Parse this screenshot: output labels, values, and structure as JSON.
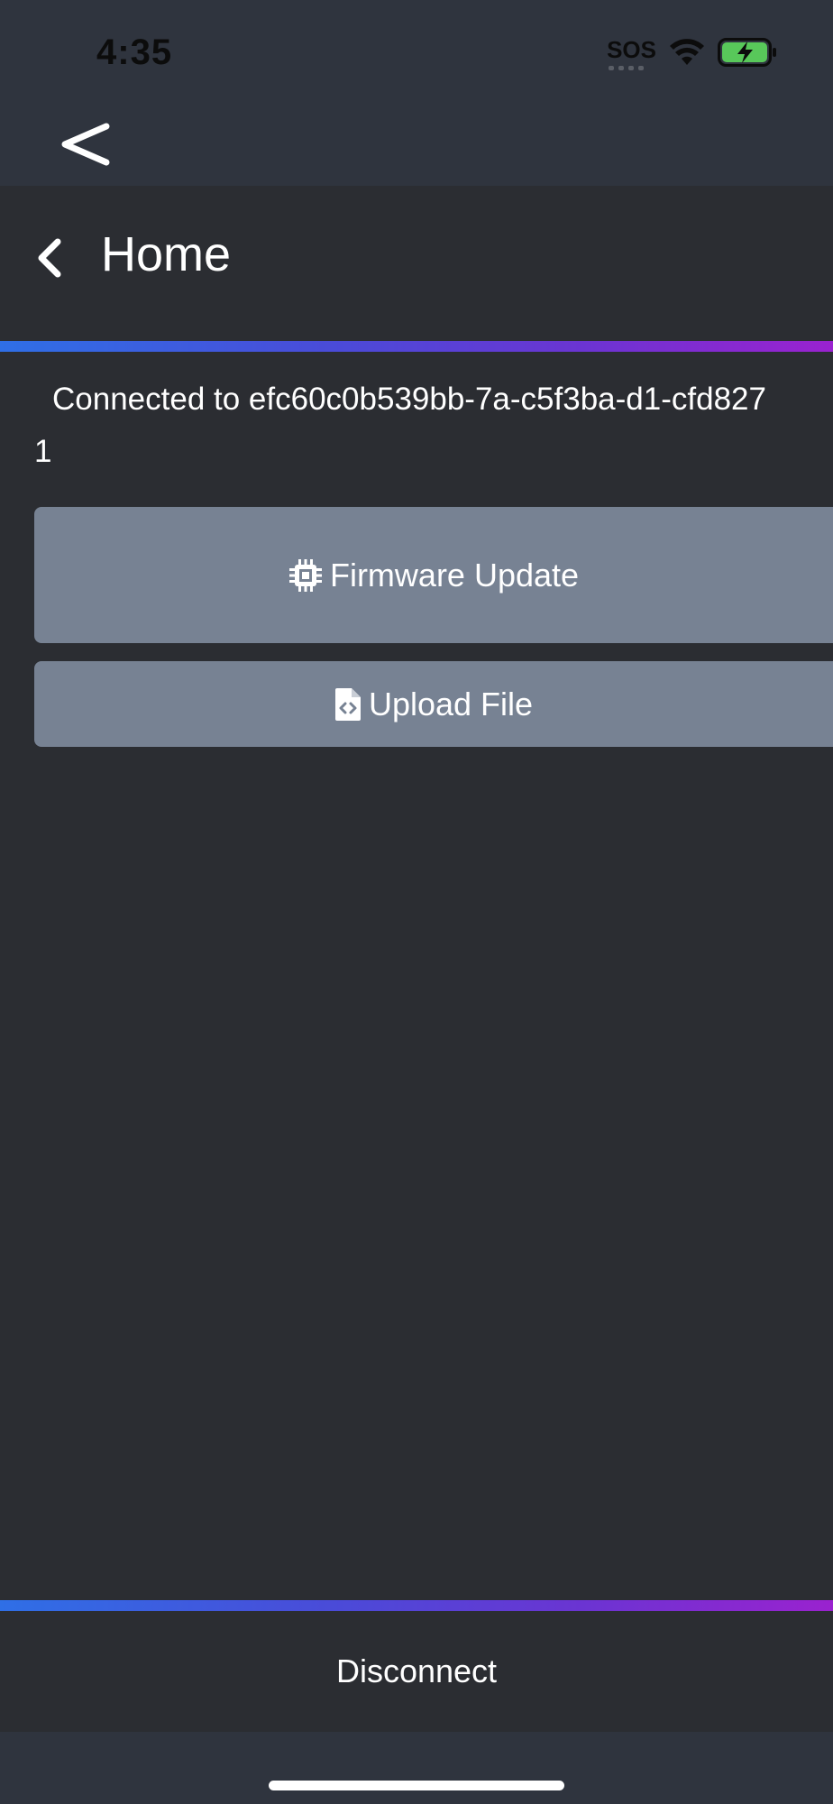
{
  "status_bar": {
    "time": "4:35",
    "sos_label": "SOS",
    "icons": [
      "sos-indicator",
      "wifi-icon",
      "battery-charging-icon"
    ],
    "battery_color": "#58c85a"
  },
  "native_nav": {
    "back_icon": "chevron-left-icon"
  },
  "header": {
    "title": "Home",
    "back_icon": "chevron-left-icon"
  },
  "connection": {
    "text": "Connected to efc60c0b539bb-7a-c5f3ba-d1-cfd8271"
  },
  "actions": {
    "firmware_update": {
      "label": "Firmware Update",
      "icon": "microchip-icon"
    },
    "upload_file": {
      "label": "Upload File",
      "icon": "file-code-icon"
    }
  },
  "footer": {
    "disconnect_label": "Disconnect"
  },
  "colors": {
    "background": "#2b2d32",
    "bars": "#2f343e",
    "button": "#778293",
    "accent_gradient_start": "#2f6fe6",
    "accent_gradient_end": "#9a22cf"
  }
}
